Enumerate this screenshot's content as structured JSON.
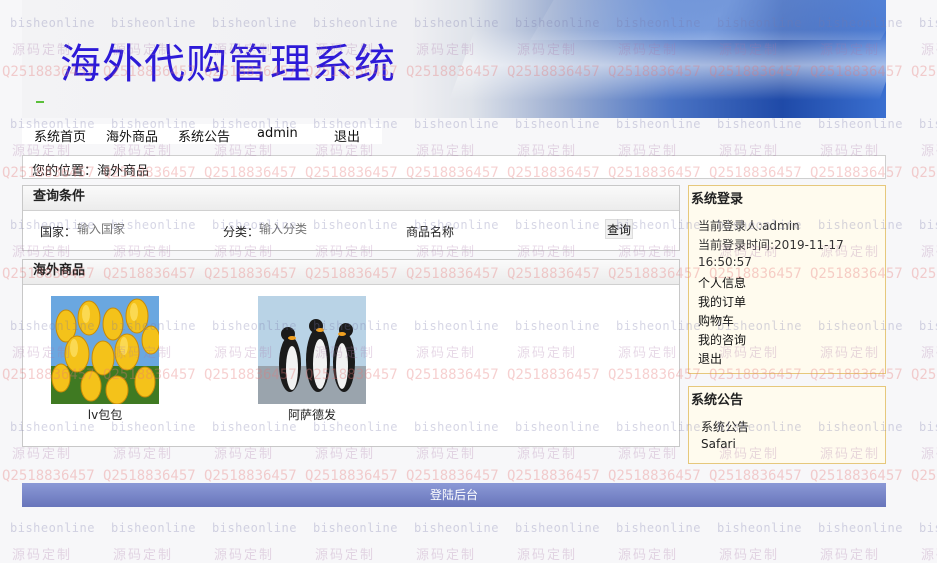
{
  "header": {
    "title": "海外代购管理系统"
  },
  "nav": {
    "items": [
      "系统首页",
      "海外商品",
      "系统公告",
      "admin",
      "退出"
    ]
  },
  "breadcrumb": {
    "text": "您的位置：海外商品"
  },
  "query": {
    "title": "查询条件",
    "country_label": "国家：",
    "country_placeholder": "输入国家",
    "category_label": "分类：",
    "category_placeholder": "输入分类",
    "name_label": "商品名称",
    "search_button": "查询"
  },
  "goods": {
    "title": "海外商品",
    "items": [
      {
        "name": "lv包包",
        "image": "tulips-photo"
      },
      {
        "name": "阿萨德发",
        "image": "penguins-photo"
      }
    ]
  },
  "login": {
    "title": "系统登录",
    "current_user": "当前登录人:admin",
    "login_time": "当前登录时间:2019-11-17",
    "login_time_2": "16:50:57",
    "links": [
      "个人信息",
      "我的订单",
      "购物车",
      "我的咨询",
      "退出"
    ]
  },
  "notice": {
    "title": "系统公告",
    "items": [
      "系统公告",
      "Safari"
    ]
  },
  "footer": {
    "link": "登陆后台"
  },
  "watermark": {
    "site": "bisheonline",
    "slogan": "源码定制",
    "qq": "Q2518836457"
  },
  "colors": {
    "title": "#2d1ad8",
    "footer": "#6875bb",
    "side_bg": "#fffbee",
    "side_border": "#e6c87c"
  }
}
